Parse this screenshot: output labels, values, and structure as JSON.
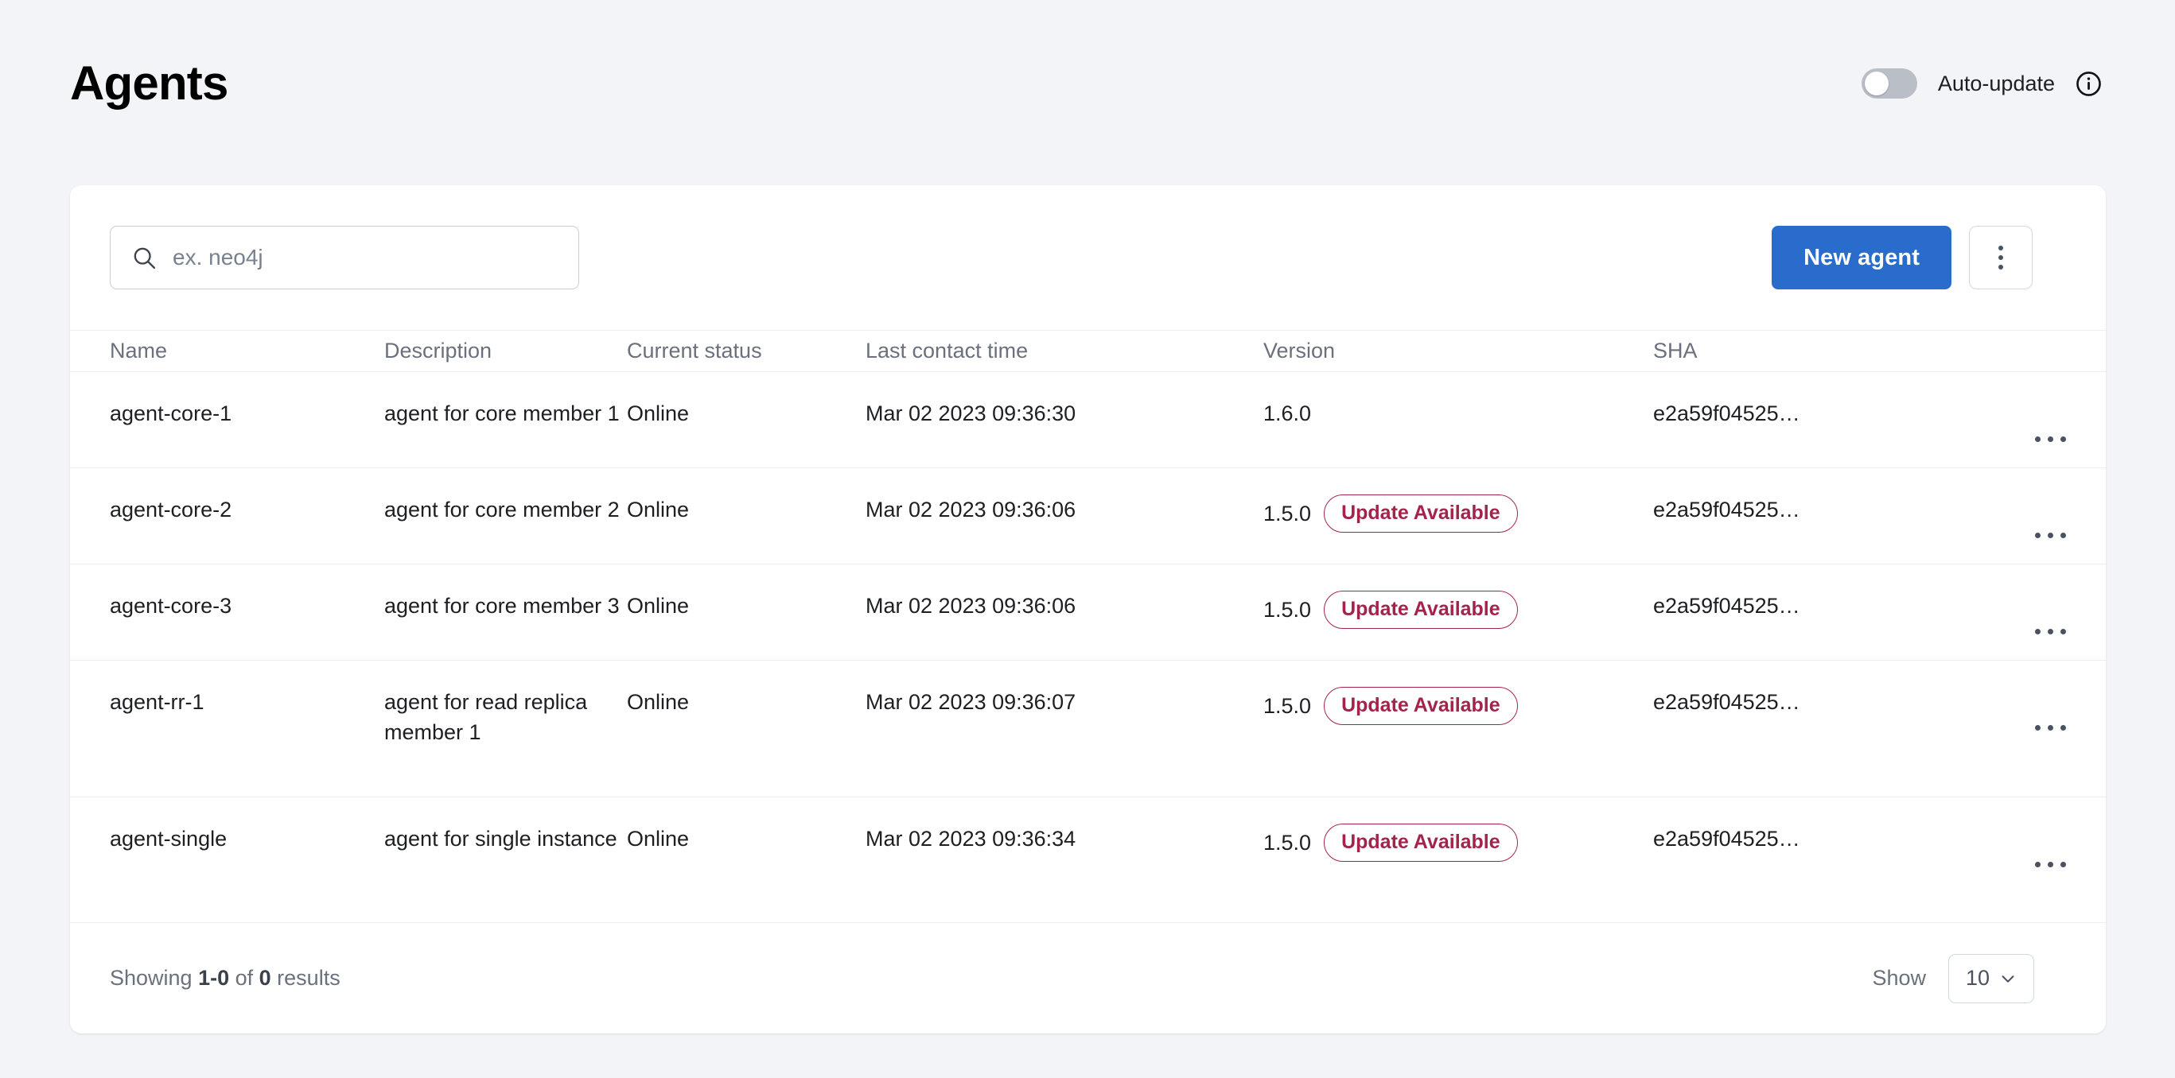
{
  "header": {
    "title": "Agents",
    "auto_update_label": "Auto-update",
    "auto_update_on": false,
    "info_icon": "info-circle-icon"
  },
  "toolbar": {
    "search_placeholder": "ex. neo4j",
    "search_value": "",
    "search_icon": "search-icon",
    "new_agent_label": "New agent",
    "overflow_icon": "vertical-dots-icon"
  },
  "table": {
    "columns": [
      "Name",
      "Description",
      "Current status",
      "Last contact time",
      "Version",
      "SHA"
    ],
    "rows": [
      {
        "name": "agent-core-1",
        "description": "agent for core member 1",
        "status": "Online",
        "last_contact": "Mar 02 2023 09:36:30",
        "version": "1.6.0",
        "badge": "",
        "sha": "e2a59f04525…",
        "actions_icon": "horizontal-dots-icon"
      },
      {
        "name": "agent-core-2",
        "description": "agent for core member 2",
        "status": "Online",
        "last_contact": "Mar 02 2023 09:36:06",
        "version": "1.5.0",
        "badge": "Update Available",
        "sha": "e2a59f04525…",
        "actions_icon": "horizontal-dots-icon"
      },
      {
        "name": "agent-core-3",
        "description": "agent for core member 3",
        "status": "Online",
        "last_contact": "Mar 02 2023 09:36:06",
        "version": "1.5.0",
        "badge": "Update Available",
        "sha": "e2a59f04525…",
        "actions_icon": "horizontal-dots-icon"
      },
      {
        "name": "agent-rr-1",
        "description": "agent for read replica member 1",
        "status": "Online",
        "last_contact": "Mar 02 2023 09:36:07",
        "version": "1.5.0",
        "badge": "Update Available",
        "sha": "e2a59f04525…",
        "actions_icon": "horizontal-dots-icon"
      },
      {
        "name": "agent-single",
        "description": "agent for single instance",
        "status": "Online",
        "last_contact": "Mar 02 2023 09:36:34",
        "version": "1.5.0",
        "badge": "Update Available",
        "sha": "e2a59f04525…",
        "actions_icon": "horizontal-dots-icon"
      }
    ]
  },
  "footer": {
    "showing_prefix": "Showing ",
    "showing_range": "1-0",
    "showing_middle": " of ",
    "showing_total": "0",
    "showing_suffix": " results",
    "show_label": "Show",
    "page_size": "10",
    "chevron_icon": "chevron-down-icon"
  },
  "colors": {
    "accent": "#2a6ccc",
    "badge": "#a3234b",
    "page_bg": "#f2f4f8",
    "card_bg": "#ffffff"
  }
}
